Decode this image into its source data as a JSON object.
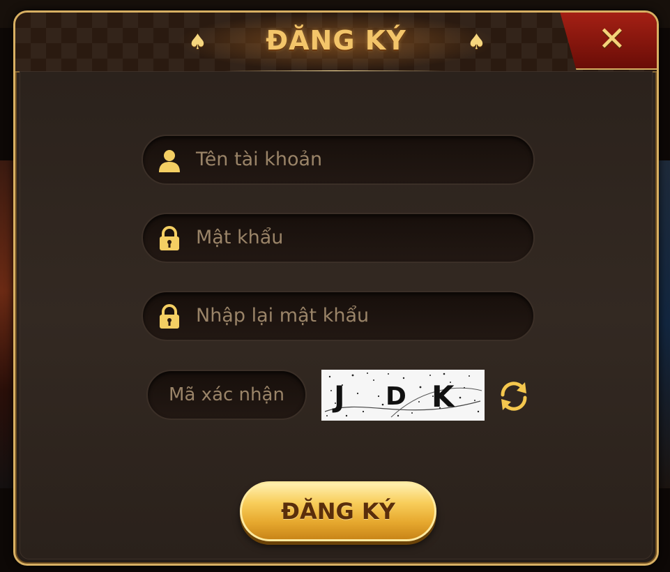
{
  "header": {
    "title": "ĐĂNG KÝ",
    "spade_glyph": "♠",
    "close_glyph": "✕"
  },
  "form": {
    "username_placeholder": "Tên tài khoản",
    "password_placeholder": "Mật khẩu",
    "confirm_placeholder": "Nhập lại mật khẩu",
    "captcha_placeholder": "Mã xác nhận",
    "captcha_code": [
      "J",
      "D",
      "K"
    ],
    "submit_label": "ĐĂNG KÝ"
  },
  "icons": {
    "username": "user-icon",
    "password": "lock-icon",
    "confirm": "lock-icon",
    "refresh": "refresh-icon",
    "close": "close-icon"
  },
  "colors": {
    "accent": "#f3c56a",
    "button": "#e6a82e",
    "close_bg": "#a42014"
  }
}
